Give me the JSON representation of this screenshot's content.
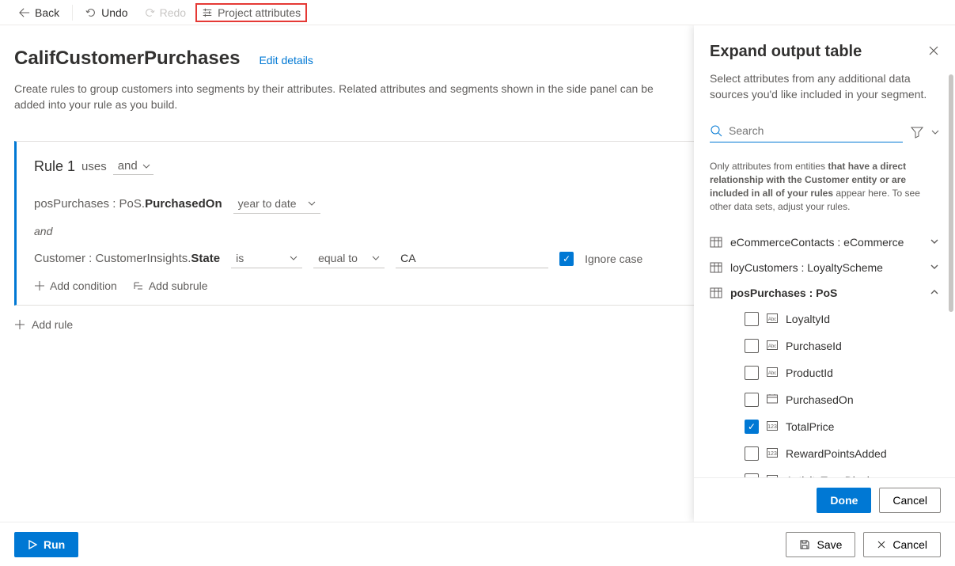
{
  "toolbar": {
    "back": "Back",
    "undo": "Undo",
    "redo": "Redo",
    "project_attr": "Project attributes"
  },
  "page": {
    "title": "CalifCustomerPurchases",
    "edit": "Edit details",
    "desc": "Create rules to group customers into segments by their attributes. Related attributes and segments shown in the side panel can be added into your rule as you build."
  },
  "rule1": {
    "title": "Rule 1",
    "uses": "uses",
    "operator": "and",
    "cond1_attr": "posPurchases : PoS.",
    "cond1_attr_bold": "PurchasedOn",
    "cond1_val": "year to date",
    "and": "and",
    "cond2_attr": "Customer : CustomerInsights.",
    "cond2_attr_bold": "State",
    "cond2_op1": "is",
    "cond2_op2": "equal to",
    "cond2_val": "CA",
    "cond2_ignore": "Ignore case",
    "add_condition": "Add condition",
    "add_subrule": "Add subrule"
  },
  "add_rule": "Add rule",
  "footer": {
    "run": "Run",
    "save": "Save",
    "cancel": "Cancel"
  },
  "panel": {
    "title": "Expand output table",
    "desc": "Select attributes from any additional data sources you'd like included in your segment.",
    "search": "Search",
    "note_pre": "Only attributes from entities ",
    "note_bold": "that have a direct relationship with the Customer entity or are included in all of your rules",
    "note_post": " appear here. To see other data sets, adjust your rules.",
    "groups": [
      {
        "label": "eCommerceContacts : eCommerce",
        "expanded": false
      },
      {
        "label": "loyCustomers : LoyaltyScheme",
        "expanded": false
      },
      {
        "label": "posPurchases : PoS",
        "expanded": true
      }
    ],
    "pos_attrs": [
      {
        "label": "LoyaltyId",
        "checked": false,
        "iconType": "abc"
      },
      {
        "label": "PurchaseId",
        "checked": false,
        "iconType": "abc"
      },
      {
        "label": "ProductId",
        "checked": false,
        "iconType": "abc"
      },
      {
        "label": "PurchasedOn",
        "checked": false,
        "iconType": "date"
      },
      {
        "label": "TotalPrice",
        "checked": true,
        "iconType": "num"
      },
      {
        "label": "RewardPointsAdded",
        "checked": false,
        "iconType": "num"
      },
      {
        "label": "ActivityTypeDisplay",
        "checked": false,
        "iconType": "abc"
      }
    ],
    "done": "Done",
    "cancel": "Cancel"
  }
}
